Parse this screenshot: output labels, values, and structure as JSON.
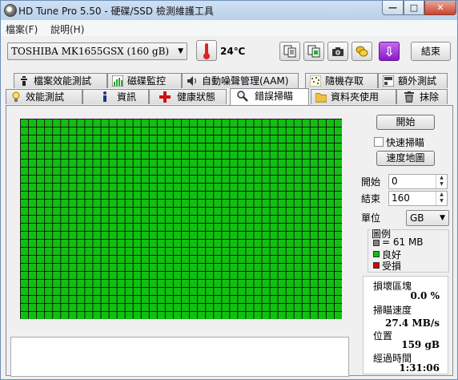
{
  "window": {
    "title": "HD Tune Pro 5.50 - 硬碟/SSD 檢測維護工具",
    "minimize_label": "—",
    "maximize_label": "□",
    "close_label": "✕"
  },
  "menu": [
    {
      "label": "檔案(F)"
    },
    {
      "label": "說明(H)"
    }
  ],
  "toolbar": {
    "drive": "TOSHIBA MK1655GSX (160 gB)",
    "temperature": "24℃",
    "exit_label": "結束",
    "icons": [
      "copy-text-icon",
      "copy-screen-icon",
      "camera-icon",
      "coins-icon",
      "save-download-icon"
    ]
  },
  "tabs_row1": [
    {
      "label": "檔案效能測試",
      "icon": "file-benchmark-icon"
    },
    {
      "label": "磁碟監控",
      "icon": "disk-monitor-icon"
    },
    {
      "label": "自動噪聲管理(AAM)",
      "icon": "speaker-icon"
    },
    {
      "label": "隨機存取",
      "icon": "random-access-icon"
    },
    {
      "label": "額外測試",
      "icon": "extra-tests-icon"
    }
  ],
  "tabs_row2": [
    {
      "label": "效能測試",
      "icon": "lightbulb-icon"
    },
    {
      "label": "資訊",
      "icon": "info-icon"
    },
    {
      "label": "健康狀態",
      "icon": "health-cross-icon"
    },
    {
      "label": "錯誤掃瞄",
      "icon": "magnifier-icon",
      "active": true
    },
    {
      "label": "資料夾使用",
      "icon": "folder-icon"
    },
    {
      "label": "抹除",
      "icon": "trash-icon"
    }
  ],
  "scan": {
    "start_button": "開始",
    "quick_scan_label": "快速掃瞄",
    "quick_scan_checked": false,
    "speed_map_button": "速度地圖",
    "start_label": "開始",
    "start_value": "0",
    "end_label": "結束",
    "end_value": "160",
    "unit_label": "單位",
    "unit_value": "GB",
    "grid_cols": 40,
    "grid_rows": 25,
    "block_color": "#10c010",
    "grid_line_color": "#1a1a1a"
  },
  "legend": {
    "title": "圖例",
    "items": [
      {
        "label": "= 61 MB",
        "color": "#808080"
      },
      {
        "label": "良好",
        "color": "#10c010"
      },
      {
        "label": "受損",
        "color": "#e00000"
      }
    ]
  },
  "stats": {
    "damaged_label": "損壞區塊",
    "damaged_value": "0.0 %",
    "speed_label": "掃瞄速度",
    "speed_value": "27.4 MB/s",
    "position_label": "位置",
    "position_value": "159 gB",
    "elapsed_label": "經過時間",
    "elapsed_value": "1:31:06"
  }
}
